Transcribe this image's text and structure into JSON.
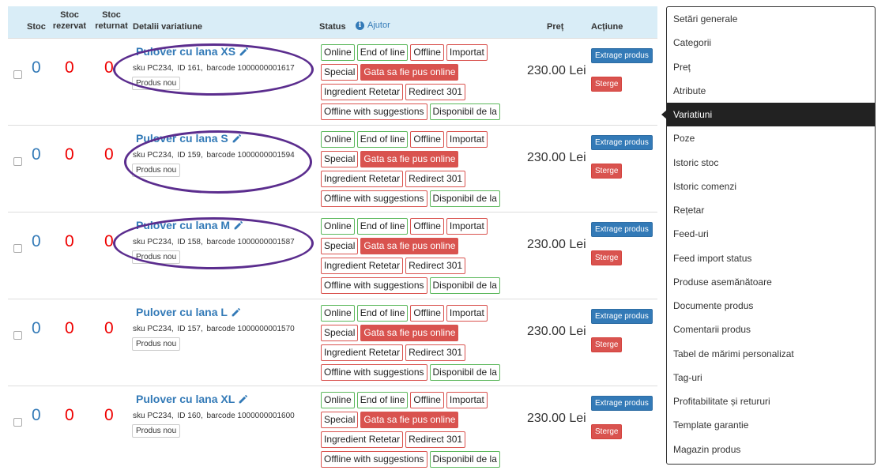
{
  "table": {
    "headers": {
      "stoc": "Stoc",
      "rezervat": "Stoc rezervat",
      "returnat": "Stoc returnat",
      "detalii": "Detalii variatiune",
      "status": "Status",
      "help_icon": "info-icon",
      "help": "Ajutor",
      "pret": "Preț",
      "actiune": "Acțiune"
    },
    "badge_rows": [
      [
        {
          "label": "Online",
          "style": "green"
        },
        {
          "label": "End of line",
          "style": "green"
        },
        {
          "label": "Offline",
          "style": "red"
        },
        {
          "label": "Importat",
          "style": "red"
        }
      ],
      [
        {
          "label": "Special",
          "style": "red"
        },
        {
          "label": "Gata sa fie pus online",
          "style": "filled"
        }
      ],
      [
        {
          "label": "Ingredient Retetar",
          "style": "red"
        },
        {
          "label": "Redirect 301",
          "style": "red"
        }
      ],
      [
        {
          "label": "Offline with suggestions",
          "style": "red"
        },
        {
          "label": "Disponibil de la",
          "style": "green"
        }
      ]
    ],
    "extract_label": "Extrage produs",
    "delete_label": "Sterge",
    "new_label": "Produs nou",
    "rows": [
      {
        "stoc": "0",
        "rezervat": "0",
        "returnat": "0",
        "name": "Pulover cu lana XS",
        "sku": "sku PC234,",
        "id": "ID 161,",
        "barcode": "barcode 1000000001617",
        "price": "230.00 Lei",
        "circled": true
      },
      {
        "stoc": "0",
        "rezervat": "0",
        "returnat": "0",
        "name": "Pulover cu lana S",
        "sku": "sku PC234,",
        "id": "ID 159,",
        "barcode": "barcode 1000000001594",
        "price": "230.00 Lei",
        "circled": true
      },
      {
        "stoc": "0",
        "rezervat": "0",
        "returnat": "0",
        "name": "Pulover cu lana M",
        "sku": "sku PC234,",
        "id": "ID 158,",
        "barcode": "barcode 1000000001587",
        "price": "230.00 Lei",
        "circled": true
      },
      {
        "stoc": "0",
        "rezervat": "0",
        "returnat": "0",
        "name": "Pulover cu lana L",
        "sku": "sku PC234,",
        "id": "ID 157,",
        "barcode": "barcode 1000000001570",
        "price": "230.00 Lei",
        "circled": false
      },
      {
        "stoc": "0",
        "rezervat": "0",
        "returnat": "0",
        "name": "Pulover cu lana XL",
        "sku": "sku PC234,",
        "id": "ID 160,",
        "barcode": "barcode 1000000001600",
        "price": "230.00 Lei",
        "circled": false
      }
    ]
  },
  "menu": {
    "active": "Variatiuni",
    "items": [
      "Setări generale",
      "Categorii",
      "Preț",
      "Atribute",
      "Variatiuni",
      "Poze",
      "Istoric stoc",
      "Istoric comenzi",
      "Rețetar",
      "Feed-uri",
      "Feed import status",
      "Produse asemănătoare",
      "Documente produs",
      "Comentarii produs",
      "Tabel de mărimi personalizat",
      "Tag-uri",
      "Profitabilitate și retururi",
      "Template garantie",
      "Magazin produs"
    ]
  },
  "colors": {
    "header_bg": "#d9edf7",
    "link": "#337ab7",
    "zero_red": "#ee0000",
    "badge_green": "#5cb85c",
    "badge_red": "#d9534f",
    "annotation": "#5b2d8e"
  }
}
